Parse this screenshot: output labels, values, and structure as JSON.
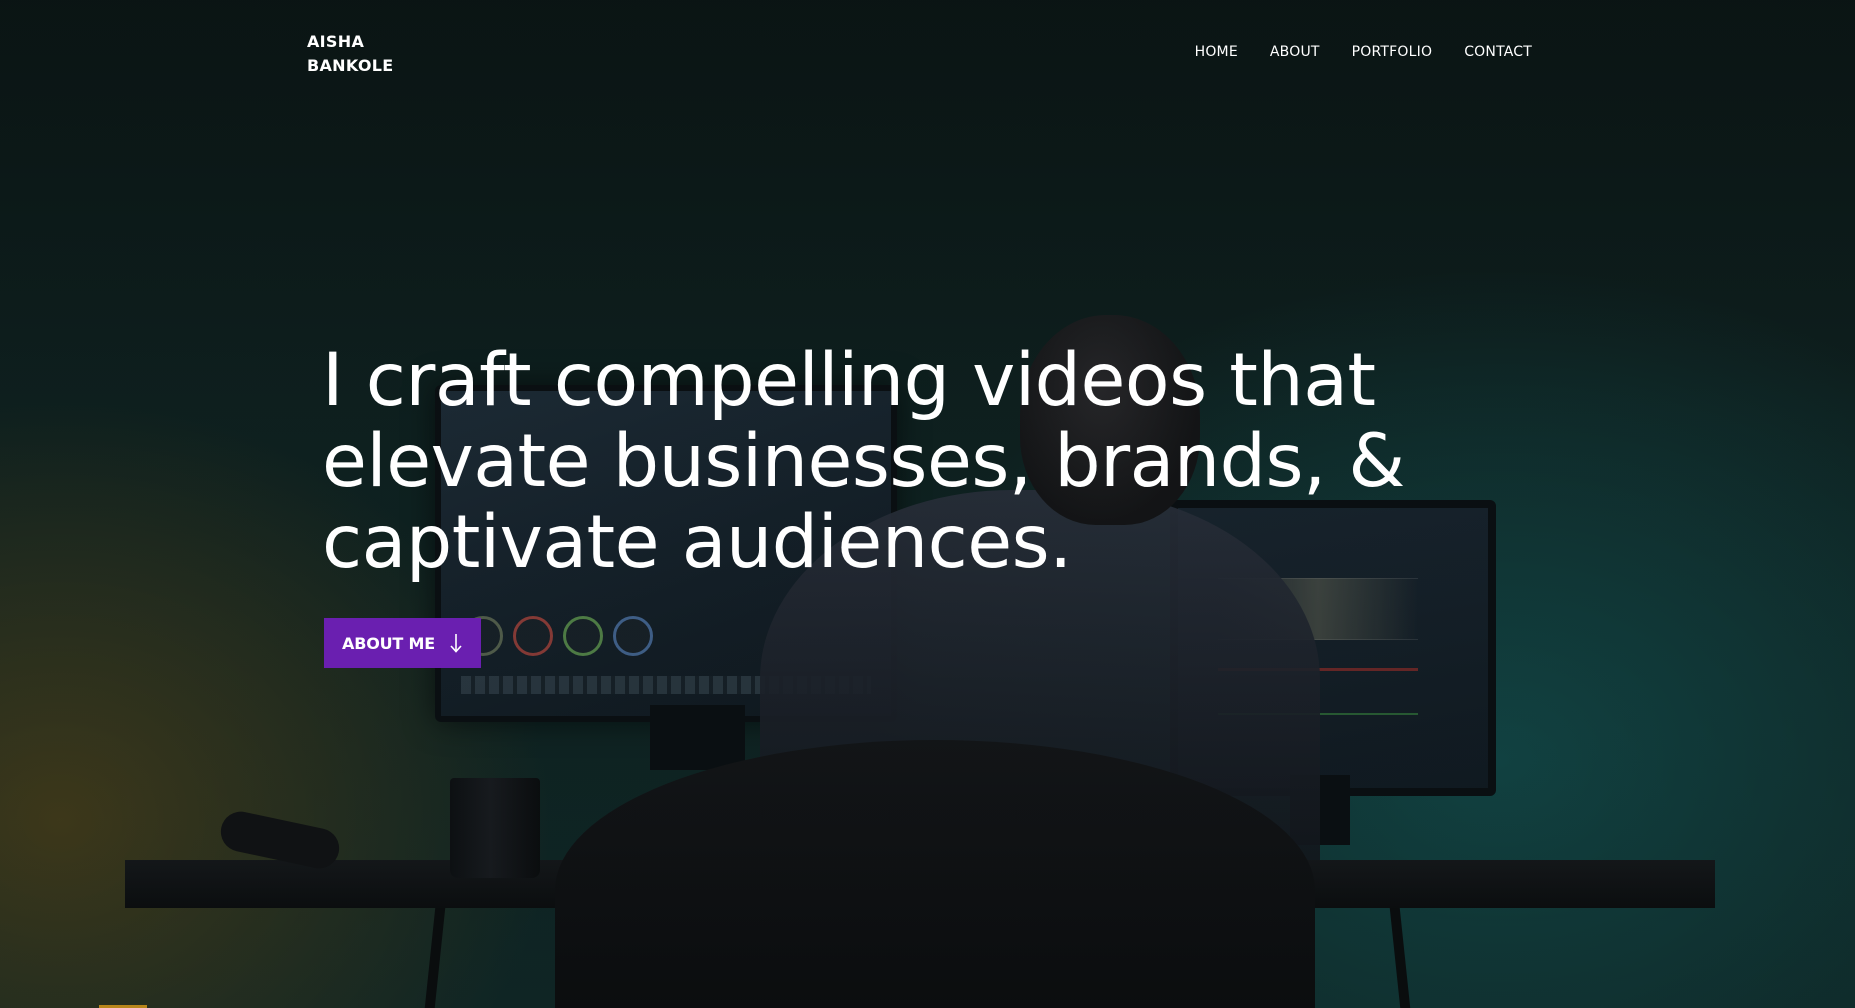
{
  "brand": {
    "line1": "AISHA",
    "line2": "BANKOLE"
  },
  "nav": {
    "items": [
      {
        "label": "HOME"
      },
      {
        "label": "ABOUT"
      },
      {
        "label": "PORTFOLIO"
      },
      {
        "label": "CONTACT"
      }
    ]
  },
  "hero": {
    "title": "I craft compelling videos that elevate businesses, brands, & captivate audiences.",
    "cta_label": "ABOUT ME",
    "cta_icon": "arrow-down-icon"
  },
  "colors": {
    "accent": "#6a1fb0",
    "text": "#ffffff",
    "background": "#0f2322"
  }
}
